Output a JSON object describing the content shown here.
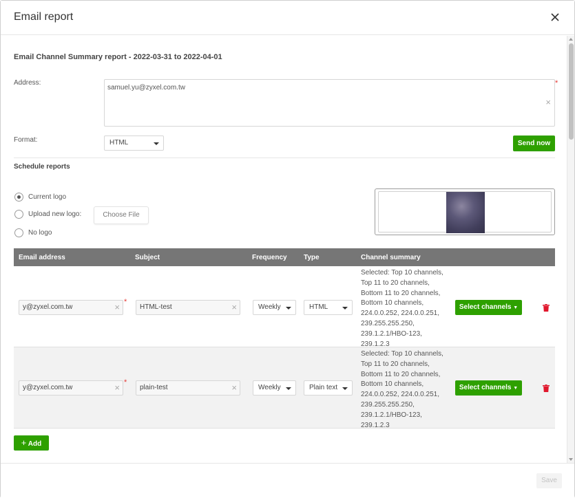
{
  "dialog": {
    "title": "Email report"
  },
  "report": {
    "title": "Email Channel Summary report - 2022-03-31  to 2022-04-01",
    "address_label": "Address:",
    "address_value": "samuel.yu@zyxel.com.tw",
    "format_label": "Format:",
    "format_value": "HTML",
    "send_now_label": "Send now"
  },
  "schedule": {
    "section_title": "Schedule reports",
    "logo_options": [
      {
        "label": "Current logo",
        "selected": true
      },
      {
        "label": "Upload new logo:",
        "selected": false
      },
      {
        "label": "No logo",
        "selected": false
      }
    ],
    "choose_file_label": "Choose File",
    "columns": [
      "Email address",
      "Subject",
      "Frequency",
      "Type",
      "Channel summary"
    ],
    "rows": [
      {
        "email": "y@zyxel.com.tw",
        "subject": "HTML-test",
        "frequency": "Weekly",
        "type": "HTML",
        "channel_summary": "Selected: Top 10 channels, Top 11 to 20 channels, Bottom 11 to 20 channels, Bottom 10 channels, 224.0.0.252, 224.0.0.251, 239.255.255.250, 239.1.2.1/HBO-123, 239.1.2.3",
        "select_label": "Select channels"
      },
      {
        "email": "y@zyxel.com.tw",
        "subject": "plain-test",
        "frequency": "Weekly",
        "type": "Plain text",
        "channel_summary": "Selected: Top 10 channels, Top 11 to 20 channels, Bottom 11 to 20 channels, Bottom 10 channels, 224.0.0.252, 224.0.0.251, 239.255.255.250, 239.1.2.1/HBO-123, 239.1.2.3",
        "select_label": "Select channels"
      }
    ],
    "add_label": "Add"
  },
  "footer": {
    "save_label": "Save"
  },
  "colors": {
    "accent": "#2ea000",
    "header_bg": "#767676",
    "required": "#e53935",
    "delete": "#e0182d"
  }
}
